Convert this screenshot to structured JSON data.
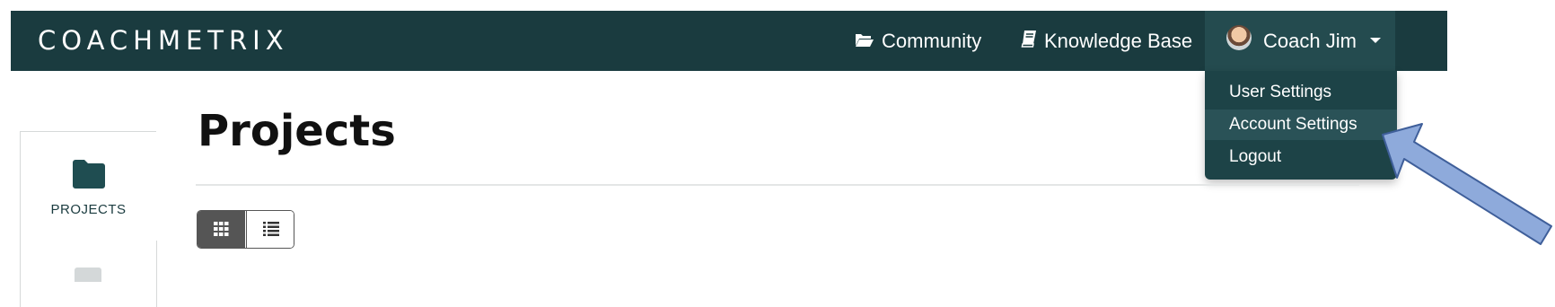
{
  "navbar": {
    "brand": "COACHMETRIX",
    "links": [
      {
        "label": "Community",
        "icon": "folder-open-icon"
      },
      {
        "label": "Knowledge Base",
        "icon": "book-icon"
      }
    ],
    "user": {
      "name": "Coach Jim",
      "icon": "avatar"
    }
  },
  "user_menu": {
    "items": [
      {
        "label": "User Settings"
      },
      {
        "label": "Account Settings",
        "highlighted": true
      },
      {
        "label": "Logout"
      }
    ]
  },
  "sidebar": {
    "items": [
      {
        "label": "PROJECTS",
        "icon": "folder-icon"
      }
    ]
  },
  "main": {
    "title": "Projects",
    "view_toggle": {
      "selected": "grid",
      "options": [
        "grid-icon",
        "list-icon"
      ]
    }
  },
  "colors": {
    "navbar": "#1a3b3f",
    "dropdown": "#1d4347",
    "highlight": "#2a5257",
    "annotation_arrow": "#8eaadb"
  }
}
